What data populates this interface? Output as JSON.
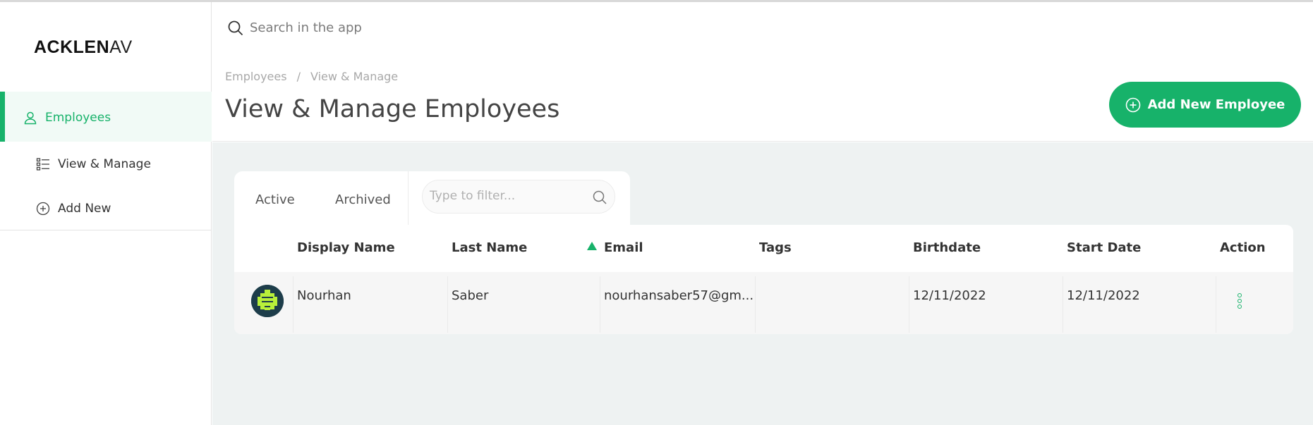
{
  "brand": {
    "logo_bold": "ACKLEN",
    "logo_light": "AV"
  },
  "sidebar": {
    "section": {
      "label": "Employees",
      "icon": "user-icon"
    },
    "items": [
      {
        "label": "View & Manage",
        "icon": "list-icon"
      },
      {
        "label": "Add New",
        "icon": "plus-circle-icon"
      }
    ]
  },
  "search": {
    "placeholder": "Search in the app"
  },
  "header": {
    "breadcrumb": [
      "Employees",
      "View & Manage"
    ],
    "breadcrumb_separator": "/",
    "title": "View & Manage Employees",
    "add_button": "Add New Employee"
  },
  "tabs": [
    {
      "label": "Active",
      "selected": true
    },
    {
      "label": "Archived",
      "selected": false
    }
  ],
  "filter": {
    "placeholder": "Type to filter..."
  },
  "table": {
    "columns": [
      "Display Name",
      "Last Name",
      "Email",
      "Tags",
      "Birthdate",
      "Start Date",
      "Action"
    ],
    "sorted_column": "Email",
    "rows": [
      {
        "display_name": "Nourhan",
        "last_name": "Saber",
        "email": "nourhansaber57@gm...",
        "tags": "",
        "birthdate": "12/11/2022",
        "start_date": "12/11/2022"
      }
    ]
  },
  "colors": {
    "accent": "#17b26a",
    "background": "#eef2f2",
    "avatar_bg": "#1d3d4a",
    "avatar_fg": "#b8f03a"
  }
}
